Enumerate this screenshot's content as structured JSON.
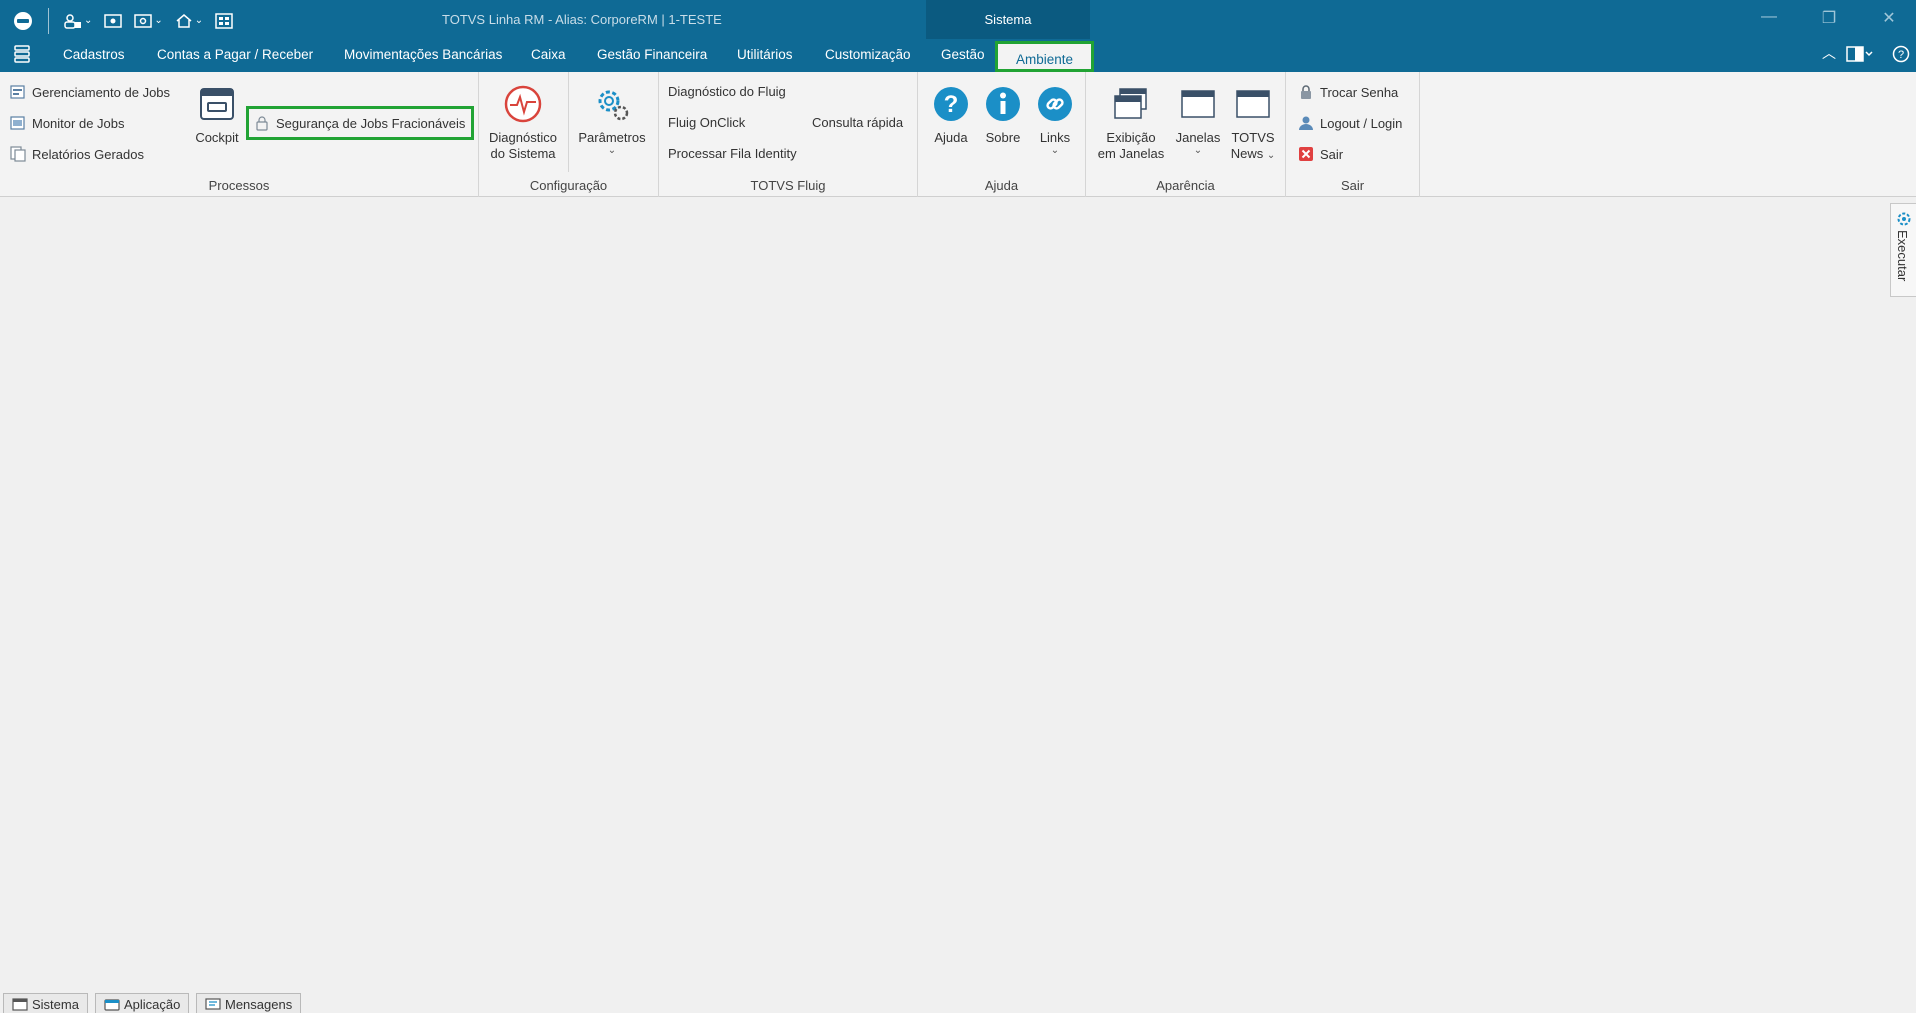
{
  "titlebar": {
    "title": "TOTVS Linha RM -  Alias: CorporeRM | 1-TESTE",
    "context_tab": "Sistema"
  },
  "menu": {
    "items": [
      "Cadastros",
      "Contas a Pagar / Receber",
      "Movimentações Bancárias",
      "Caixa",
      "Gestão Financeira",
      "Utilitários",
      "Customização",
      "Gestão",
      "Ambiente"
    ],
    "active": "Ambiente"
  },
  "ribbon": {
    "processos": {
      "label": "Processos",
      "items": [
        "Gerenciamento de Jobs",
        "Monitor de Jobs",
        "Relatórios Gerados"
      ],
      "cockpit": "Cockpit",
      "seguranca": "Segurança de Jobs Fracionáveis"
    },
    "configuracao": {
      "label": "Configuração",
      "diagnostico_l1": "Diagnóstico",
      "diagnostico_l2": "do Sistema",
      "parametros": "Parâmetros"
    },
    "fluig": {
      "label": "TOTVS Fluig",
      "items": [
        "Diagnóstico do Fluig",
        "Fluig OnClick",
        "Processar Fila Identity"
      ],
      "consulta": "Consulta rápida"
    },
    "ajuda": {
      "label": "Ajuda",
      "ajuda": "Ajuda",
      "sobre": "Sobre",
      "links": "Links"
    },
    "aparencia": {
      "label": "Aparência",
      "exibicao_l1": "Exibição",
      "exibicao_l2": "em Janelas",
      "janelas": "Janelas",
      "news_l1": "TOTVS",
      "news_l2": "News"
    },
    "sair": {
      "label": "Sair",
      "trocar": "Trocar Senha",
      "logout": "Logout / Login",
      "sair": "Sair"
    }
  },
  "side_tab": {
    "label": "Executar"
  },
  "bottom_tabs": [
    "Sistema",
    "Aplicação",
    "Mensagens"
  ],
  "colors": {
    "header_blue": "#0f6a95",
    "highlight_green": "#21a334",
    "help_blue": "#1b8fc7",
    "diag_red": "#d9443c"
  }
}
